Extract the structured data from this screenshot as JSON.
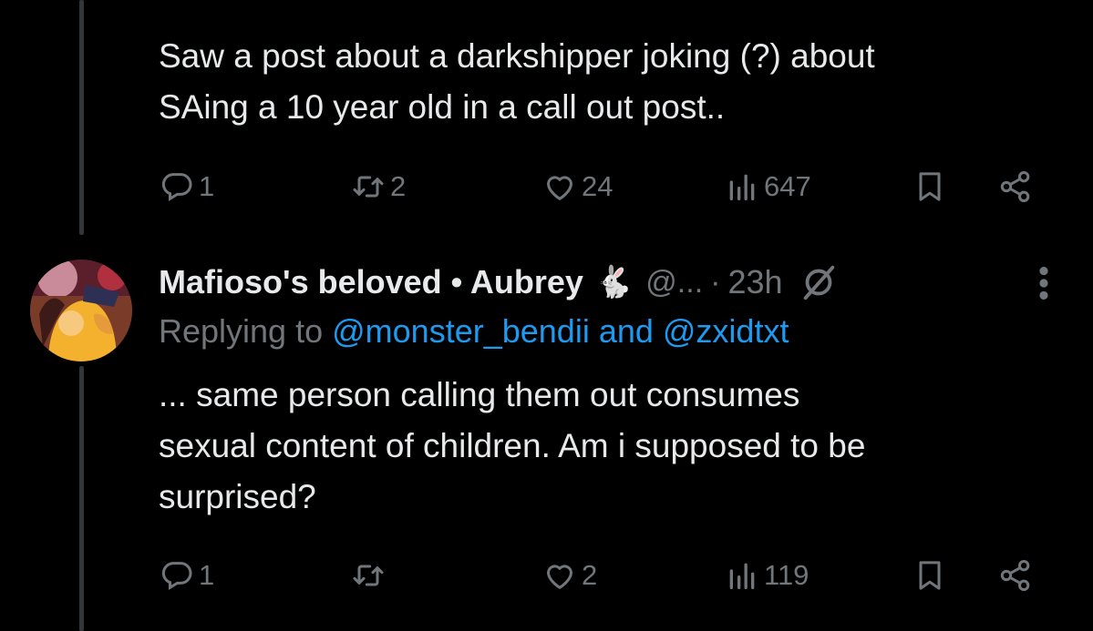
{
  "first_tweet": {
    "text": "Saw a post about a darkshipper joking (?) about\nSAing a 10 year old in a call out post..",
    "actions": {
      "replies": "1",
      "retweets": "2",
      "likes": "24",
      "views": "647"
    }
  },
  "second_tweet": {
    "author_name": "Mafioso's beloved • Aubrey",
    "name_emoji": "🐇",
    "handle": "@...",
    "separator": "·",
    "time": "23h",
    "replying_prefix": "Replying to",
    "replying_mentions": "@monster_bendii and @zxidtxt",
    "text": "... same person calling them out consumes\nsexual content of children. Am i supposed to be\nsurprised?",
    "actions": {
      "replies": "1",
      "retweets": "",
      "likes": "2",
      "views": "119"
    }
  },
  "icons": {
    "reply": "reply-icon",
    "retweet": "retweet-icon",
    "like": "heart-icon",
    "views": "views-icon",
    "bookmark": "bookmark-icon",
    "share": "share-icon",
    "muted": "muted-icon",
    "more": "more-icon"
  },
  "colors": {
    "background": "#000000",
    "text": "#e7e9ea",
    "muted": "#71767b",
    "link": "#1d9bf0",
    "thread_line": "#333639"
  }
}
